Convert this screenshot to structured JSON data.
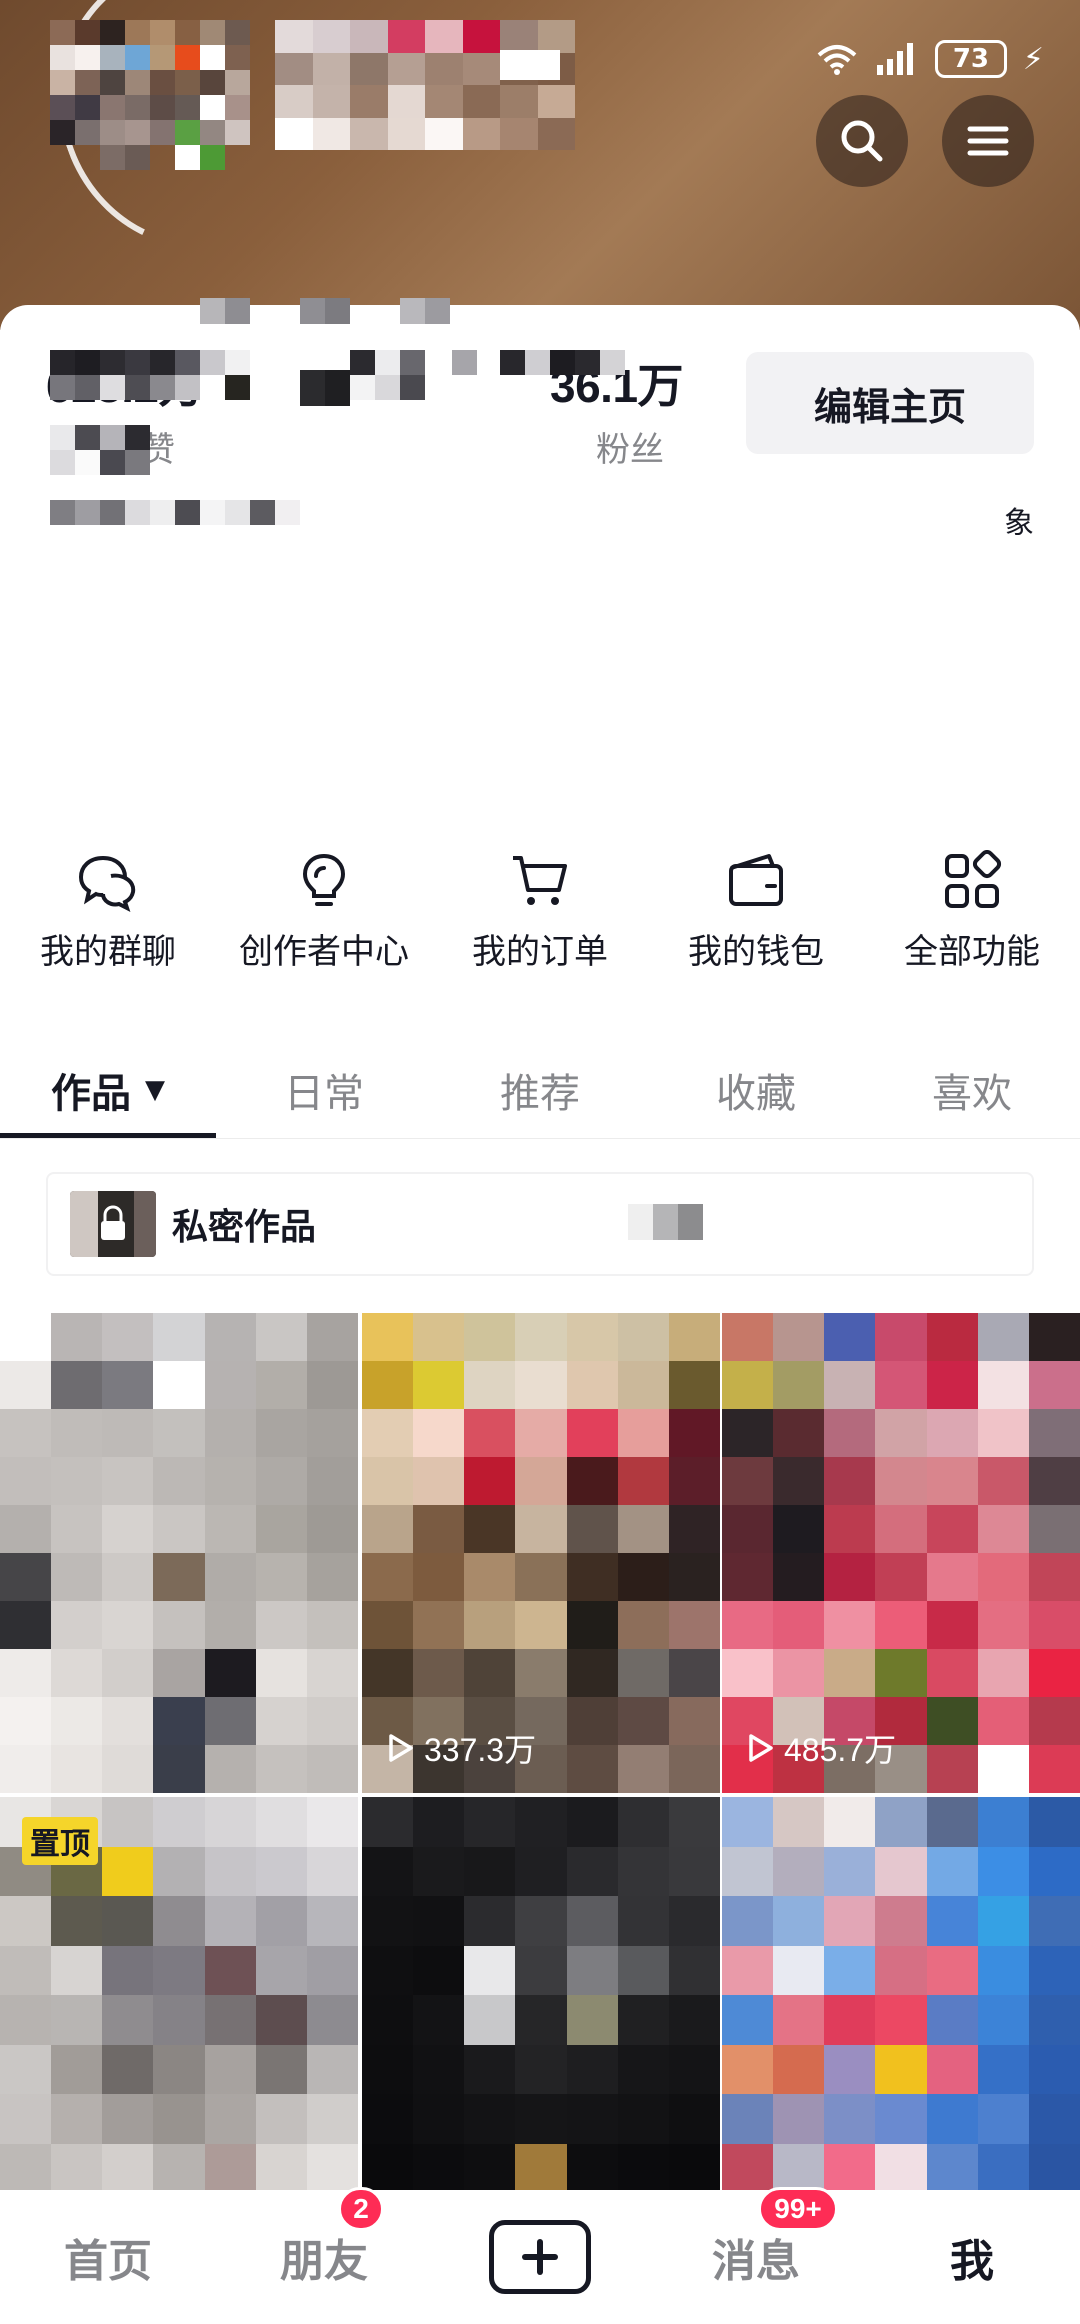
{
  "status_bar": {
    "battery": "73",
    "bolt": "⚡"
  },
  "header": {
    "search_icon": "search-icon",
    "menu_icon": "menu-icon"
  },
  "stats": {
    "likes": {
      "value": "628.2万",
      "label": "获赞"
    },
    "fans": {
      "value": "36.1万",
      "label": "粉丝"
    }
  },
  "edit_button": "编辑主页",
  "bio_visible_char": "象",
  "quick_functions": [
    {
      "label": "我的群聊",
      "icon": "chat-bubbles-icon"
    },
    {
      "label": "创作者中心",
      "icon": "lightbulb-icon"
    },
    {
      "label": "我的订单",
      "icon": "cart-icon"
    },
    {
      "label": "我的钱包",
      "icon": "wallet-icon"
    },
    {
      "label": "全部功能",
      "icon": "grid-icon"
    }
  ],
  "tabs": [
    {
      "label": "作品",
      "active": true,
      "caret": "▼"
    },
    {
      "label": "日常"
    },
    {
      "label": "推荐"
    },
    {
      "label": "收藏"
    },
    {
      "label": "喜欢"
    }
  ],
  "private_works": {
    "label": "私密作品"
  },
  "grid": {
    "tiles": [
      {
        "views": ""
      },
      {
        "views": "337.3万"
      },
      {
        "views": "485.7万"
      },
      {
        "views": "",
        "pin": "置顶"
      },
      {
        "views": ""
      },
      {
        "views": ""
      }
    ]
  },
  "bottom_nav": {
    "home": "首页",
    "friends": "朋友",
    "friends_badge": "2",
    "messages": "消息",
    "messages_badge": "99+",
    "me": "我"
  },
  "colors": {
    "accent": "#fe2c55",
    "text": "#161823",
    "muted": "#86878b",
    "pin": "#f5d52a"
  }
}
